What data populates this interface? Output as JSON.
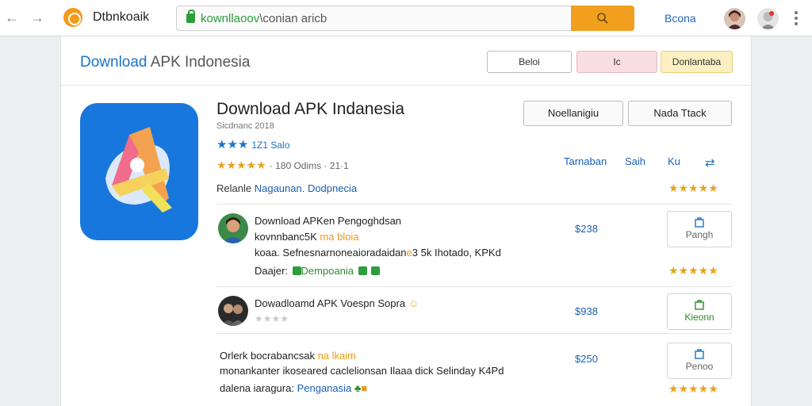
{
  "browser": {
    "back_icon": "back-arrow-icon",
    "forward_icon": "forward-arrow-icon",
    "site_name": "Dtbnkoaik",
    "url_prefix": "kownllaoov",
    "url_rest": "\\conian aricb",
    "top_link": "Bcona",
    "accent": "#f0a01e"
  },
  "header": {
    "title_blue": "Download",
    "title_rest": " APK Indonesia",
    "btn1": "Beloi",
    "btn2": "Ic",
    "btn3": "Donlantaba"
  },
  "app": {
    "title": "Download APK Indanesia",
    "subtitle": "Sicdnanc 2018",
    "rating_blue_stars": "★★★",
    "rating_blue_text": "1Z1 Salo",
    "rating_gold_stars": "★★★★★",
    "rating_gold_text": "· 180 Odims · 21·1",
    "related_label": "Relanle",
    "related_value": "Nagaunan. Dodpnecia",
    "option1": "Noellanigiu",
    "option2": "Nada Ttack"
  },
  "columns": {
    "c1": "Tarnaban",
    "c2": "Saih",
    "c3": "Ku",
    "share_icon": "share-icon",
    "stars": "★★★★★"
  },
  "rows": [
    {
      "line1": "Download APKen Pengoghdsan",
      "line2a": "kovnnbanc5K ",
      "line2b": "ma bloia",
      "line3a": "koaa. Sefnesnarnoneaioradaidan",
      "line3b": "e",
      "line3c": "3 5k Ihotado, KPKd",
      "line4a": "Daajer: ",
      "line4b": "Dempoania",
      "price": "$238",
      "button": "Pangh",
      "stars": "★★★★★"
    },
    {
      "line1": "Dowadloamd APK Voespn Sopra",
      "stars_grey": "★★★★",
      "price": "$938",
      "button": "Kieonn"
    },
    {
      "line1a": "Orlerk bocrabancsak ",
      "line1b": "na lkaim",
      "line2": "monankanter ikoseared caclelionsan Ilaaa dick Selinday K4Pd",
      "line3a": "dalena iaragura: ",
      "line3b": "Penganasia",
      "price": "$250",
      "button": "Penoo",
      "stars": "★★★★★"
    }
  ]
}
